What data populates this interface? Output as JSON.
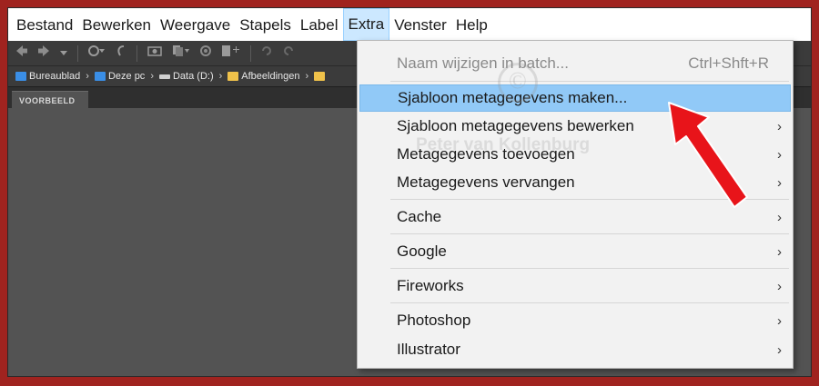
{
  "menubar": {
    "items": [
      "Bestand",
      "Bewerken",
      "Weergave",
      "Stapels",
      "Label",
      "Extra",
      "Venster",
      "Help"
    ],
    "active": "Extra"
  },
  "toolbar": {
    "icons": [
      "back-arrow-icon",
      "forward-arrow-icon",
      "history-dropdown-icon",
      "recent-folders-icon",
      "return-icon",
      "get-photos-icon",
      "copy-icon",
      "refine-icon",
      "new-file-icon",
      "rotate-left-icon",
      "rotate-right-icon"
    ]
  },
  "pathbar": {
    "crumbs": [
      {
        "label": "Bureaublad",
        "icon": "desktop-icon",
        "color": "#3a8ee6"
      },
      {
        "label": "Deze pc",
        "icon": "computer-icon",
        "color": "#3a8ee6"
      },
      {
        "label": "Data (D:)",
        "icon": "drive-icon",
        "color": "#d0d0d0"
      },
      {
        "label": "Afbeeldingen",
        "icon": "folder-icon",
        "color": "#f0c24a"
      }
    ],
    "trailing_icon_color": "#f0c24a"
  },
  "panel": {
    "tab_label": "VOORBEELD"
  },
  "dropdown": {
    "items": [
      {
        "label": "Naam wijzigen in batch...",
        "shortcut": "Ctrl+Shft+R",
        "submenu": false,
        "disabled": true
      },
      {
        "label": "Sjabloon metagegevens maken...",
        "shortcut": "",
        "submenu": false,
        "highlight": true
      },
      {
        "label": "Sjabloon metagegevens bewerken",
        "shortcut": "",
        "submenu": true
      },
      {
        "label": "Metagegevens toevoegen",
        "shortcut": "",
        "submenu": true
      },
      {
        "label": "Metagegevens vervangen",
        "shortcut": "",
        "submenu": true
      },
      {
        "label": "Cache",
        "shortcut": "",
        "submenu": true
      },
      {
        "label": "Google",
        "shortcut": "",
        "submenu": true
      },
      {
        "label": "Fireworks",
        "shortcut": "",
        "submenu": true
      },
      {
        "label": "Photoshop",
        "shortcut": "",
        "submenu": true
      },
      {
        "label": "Illustrator",
        "shortcut": "",
        "submenu": true
      }
    ],
    "submenu_glyph": "›"
  },
  "watermark": {
    "symbol": "©",
    "text": "Peter van Kollenburg"
  },
  "colors": {
    "frame": "#a0231f",
    "highlight": "#91c9f7",
    "menu_active": "#cce8ff",
    "annotation_arrow": "#e8141a"
  }
}
